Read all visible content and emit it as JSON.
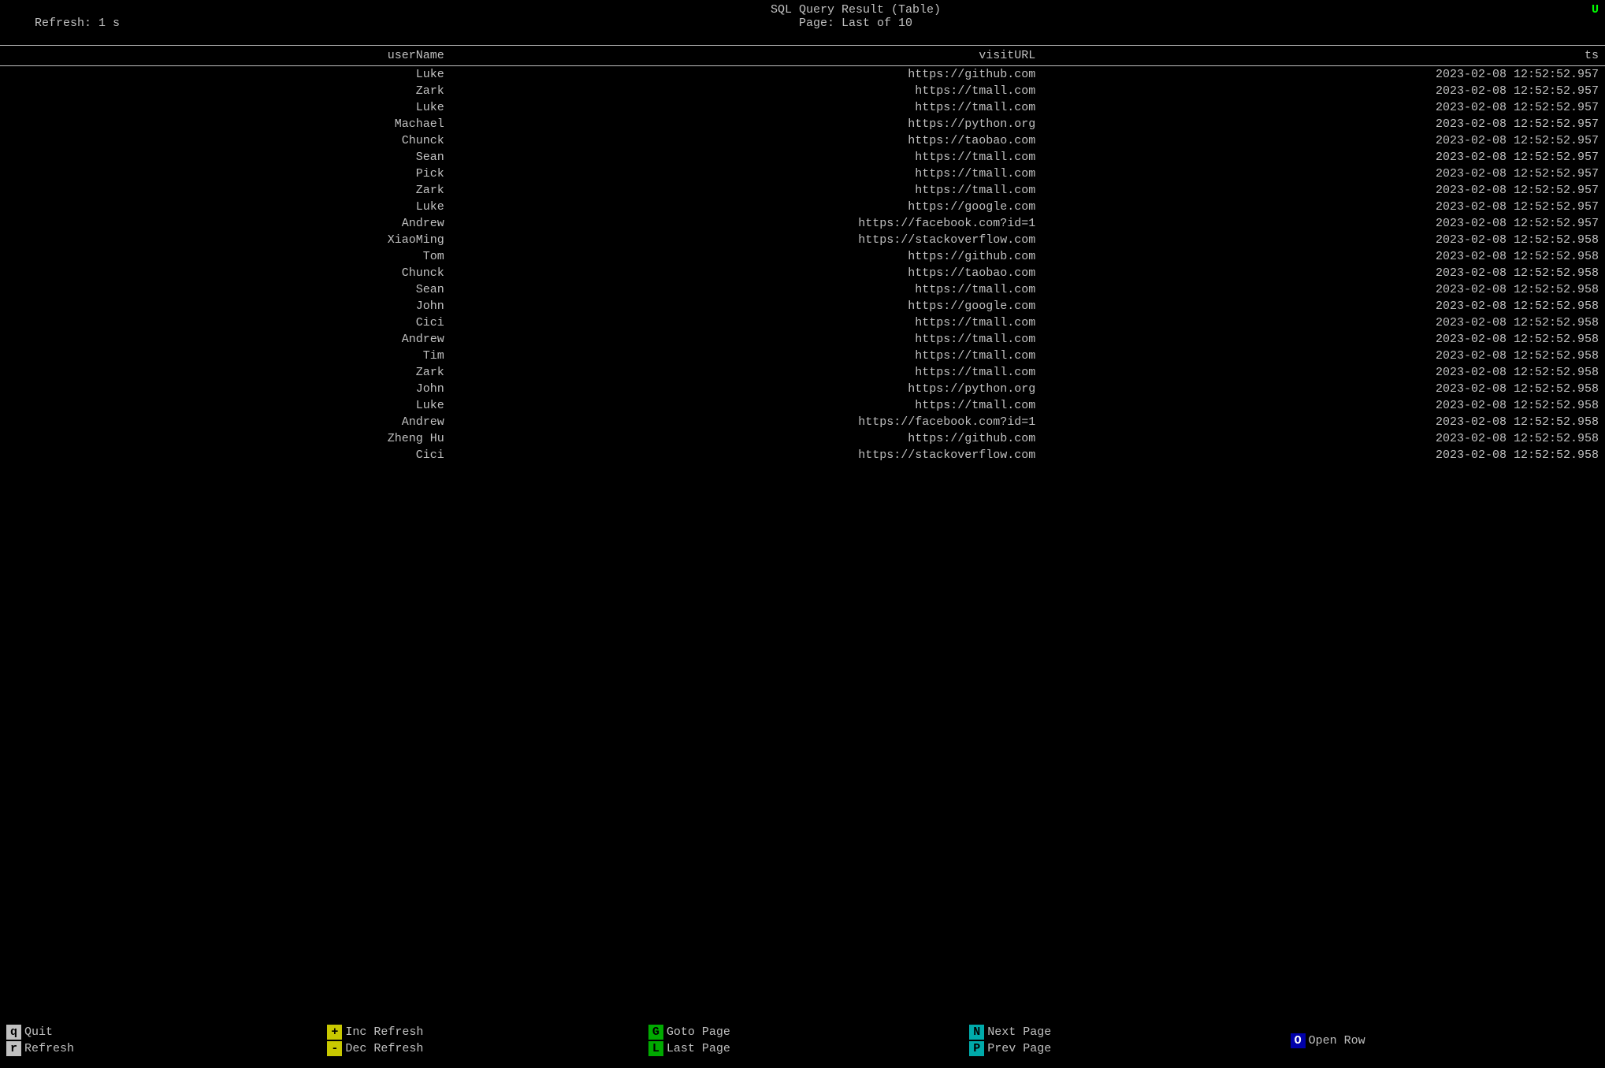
{
  "header": {
    "title": "SQL Query Result (Table)",
    "page_info": "Page: Last of 10",
    "refresh_info": "Refresh: 1 s",
    "indicator": "U"
  },
  "columns": [
    {
      "key": "userName",
      "label": "userName"
    },
    {
      "key": "visitURL",
      "label": "visitURL"
    },
    {
      "key": "ts",
      "label": "ts"
    }
  ],
  "rows": [
    {
      "userName": "Luke",
      "visitURL": "https://github.com",
      "ts": "2023-02-08 12:52:52.957"
    },
    {
      "userName": "Zark",
      "visitURL": "https://tmall.com",
      "ts": "2023-02-08 12:52:52.957"
    },
    {
      "userName": "Luke",
      "visitURL": "https://tmall.com",
      "ts": "2023-02-08 12:52:52.957"
    },
    {
      "userName": "Machael",
      "visitURL": "https://python.org",
      "ts": "2023-02-08 12:52:52.957"
    },
    {
      "userName": "Chunck",
      "visitURL": "https://taobao.com",
      "ts": "2023-02-08 12:52:52.957"
    },
    {
      "userName": "Sean",
      "visitURL": "https://tmall.com",
      "ts": "2023-02-08 12:52:52.957"
    },
    {
      "userName": "Pick",
      "visitURL": "https://tmall.com",
      "ts": "2023-02-08 12:52:52.957"
    },
    {
      "userName": "Zark",
      "visitURL": "https://tmall.com",
      "ts": "2023-02-08 12:52:52.957"
    },
    {
      "userName": "Luke",
      "visitURL": "https://google.com",
      "ts": "2023-02-08 12:52:52.957"
    },
    {
      "userName": "Andrew",
      "visitURL": "https://facebook.com?id=1",
      "ts": "2023-02-08 12:52:52.957"
    },
    {
      "userName": "XiaoMing",
      "visitURL": "https://stackoverflow.com",
      "ts": "2023-02-08 12:52:52.958"
    },
    {
      "userName": "Tom",
      "visitURL": "https://github.com",
      "ts": "2023-02-08 12:52:52.958"
    },
    {
      "userName": "Chunck",
      "visitURL": "https://taobao.com",
      "ts": "2023-02-08 12:52:52.958"
    },
    {
      "userName": "Sean",
      "visitURL": "https://tmall.com",
      "ts": "2023-02-08 12:52:52.958"
    },
    {
      "userName": "John",
      "visitURL": "https://google.com",
      "ts": "2023-02-08 12:52:52.958"
    },
    {
      "userName": "Cici",
      "visitURL": "https://tmall.com",
      "ts": "2023-02-08 12:52:52.958"
    },
    {
      "userName": "Andrew",
      "visitURL": "https://tmall.com",
      "ts": "2023-02-08 12:52:52.958"
    },
    {
      "userName": "Tim",
      "visitURL": "https://tmall.com",
      "ts": "2023-02-08 12:52:52.958"
    },
    {
      "userName": "Zark",
      "visitURL": "https://tmall.com",
      "ts": "2023-02-08 12:52:52.958"
    },
    {
      "userName": "John",
      "visitURL": "https://python.org",
      "ts": "2023-02-08 12:52:52.958"
    },
    {
      "userName": "Luke",
      "visitURL": "https://tmall.com",
      "ts": "2023-02-08 12:52:52.958"
    },
    {
      "userName": "Andrew",
      "visitURL": "https://facebook.com?id=1",
      "ts": "2023-02-08 12:52:52.958"
    },
    {
      "userName": "Zheng Hu",
      "visitURL": "https://github.com",
      "ts": "2023-02-08 12:52:52.958"
    },
    {
      "userName": "Cici",
      "visitURL": "https://stackoverflow.com",
      "ts": "2023-02-08 12:52:52.958"
    }
  ],
  "footer": {
    "sections": [
      {
        "items": [
          {
            "key": "q",
            "key_display": "q",
            "label": "Quit"
          },
          {
            "key": "r",
            "key_display": "r",
            "label": "Refresh"
          }
        ]
      },
      {
        "items": [
          {
            "key": "+",
            "key_display": "+",
            "label": "Inc Refresh"
          },
          {
            "key": "-",
            "key_display": "-",
            "label": "Dec Refresh"
          }
        ]
      },
      {
        "items": [
          {
            "key": "G",
            "key_display": "G",
            "label": "Goto Page"
          },
          {
            "key": "L",
            "key_display": "L",
            "label": "Last Page"
          }
        ]
      },
      {
        "items": [
          {
            "key": "N",
            "key_display": "N",
            "label": "Next Page"
          },
          {
            "key": "P",
            "key_display": "P",
            "label": "Prev Page"
          }
        ]
      },
      {
        "items": [
          {
            "key": "O",
            "key_display": "O",
            "label": "Open Row"
          }
        ]
      }
    ]
  }
}
